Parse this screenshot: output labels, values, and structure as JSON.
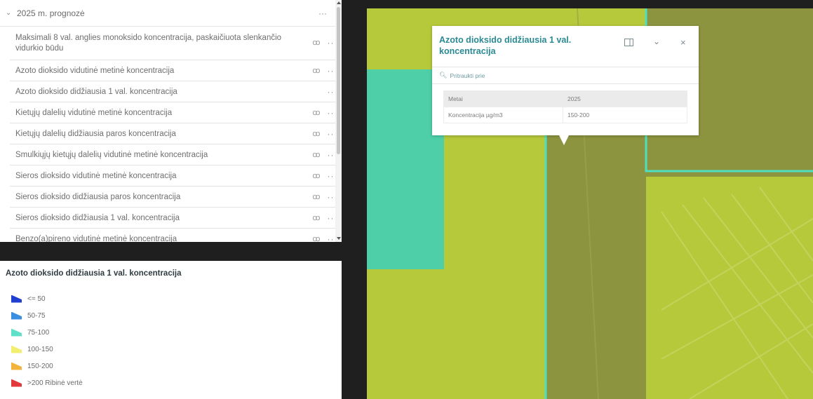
{
  "layer_list": {
    "group": {
      "label": "2025 m. prognozė",
      "more": "···"
    },
    "layers": [
      {
        "label": "Maksimali 8 val. anglies monoksido koncentracija, paskaičiuota slenkančio vidurkio būdu",
        "eye": "ꝏ",
        "more": "···",
        "tall": true
      },
      {
        "label": "Azoto dioksido vidutinė metinė koncentracija",
        "eye": "ꝏ",
        "more": "···"
      },
      {
        "label": "Azoto dioksido didžiausia 1 val. koncentracija",
        "eye": "",
        "more": "···"
      },
      {
        "label": "Kietųjų dalelių vidutinė metinė koncentracija",
        "eye": "ꝏ",
        "more": "···"
      },
      {
        "label": "Kietųjų dalelių didžiausia paros koncentracija",
        "eye": "ꝏ",
        "more": "···"
      },
      {
        "label": "Smulkiųjų kietųjų dalelių vidutinė metinė koncentracija",
        "eye": "ꝏ",
        "more": "···"
      },
      {
        "label": "Sieros dioksido vidutinė metinė koncentracija",
        "eye": "ꝏ",
        "more": "···"
      },
      {
        "label": "Sieros dioksido didžiausia paros koncentracija",
        "eye": "ꝏ",
        "more": "···"
      },
      {
        "label": "Sieros dioksido didžiausia 1 val. koncentracija",
        "eye": "ꝏ",
        "more": "···"
      },
      {
        "label": "Benzo(a)pireno vidutinė metinė koncentracija",
        "eye": "ꝏ",
        "more": "···"
      }
    ]
  },
  "legend": {
    "title": "Azoto dioksido didžiausia 1 val. koncentracija",
    "items": [
      {
        "label": "<= 50",
        "color": "#1f3fd0"
      },
      {
        "label": "50-75",
        "color": "#3b8fe0"
      },
      {
        "label": "75-100",
        "color": "#5fe0c8"
      },
      {
        "label": "100-150",
        "color": "#f2ee70"
      },
      {
        "label": "150-200",
        "color": "#f2b43a"
      },
      {
        "label": ">200 Ribinė vertė",
        "color": "#e23a3a"
      }
    ]
  },
  "popup": {
    "title": "Azoto dioksido didžiausia 1 val. koncentracija",
    "dock_icon": "dock-icon",
    "collapse_icon": "chevron-down-icon",
    "close_icon": "close-icon",
    "zoom_label": "Pritraukti prie",
    "table": [
      {
        "key": "Metai",
        "value": "2025"
      },
      {
        "key": "Koncentracija µg/m3",
        "value": "150-200"
      }
    ]
  },
  "map_colors": {
    "base": "#b6c93b",
    "dark": "#8c9440",
    "teal": "#4fcfa8",
    "outline": "#4de0c0"
  }
}
